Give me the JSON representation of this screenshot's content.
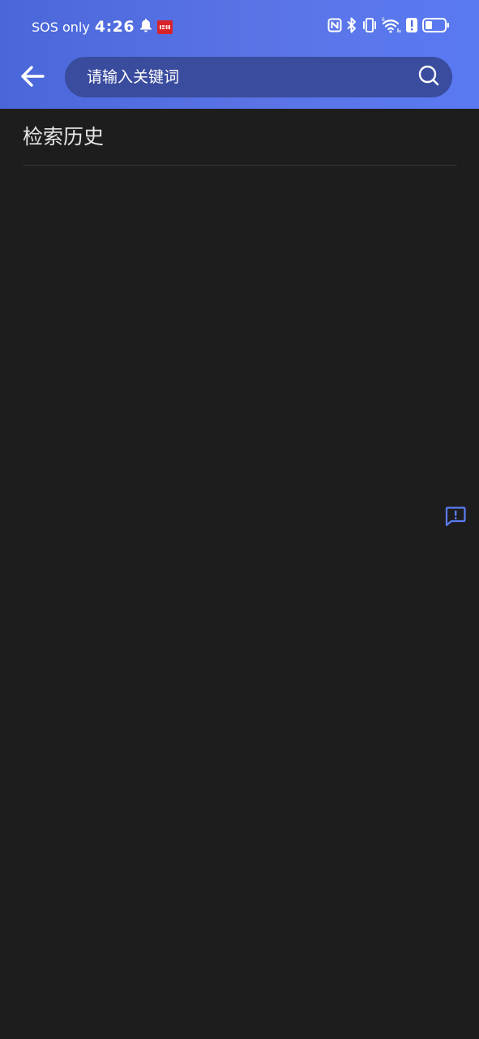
{
  "status_bar": {
    "carrier": "SOS only",
    "time": "4:26",
    "app_badge_icon": "app-notification-badge-icon",
    "icons": [
      "bell-icon",
      "nfc-icon",
      "bluetooth-icon",
      "vibrate-icon",
      "wifi-6-icon",
      "alert-icon",
      "battery-icon"
    ]
  },
  "toolbar": {
    "back_icon": "arrow-left-icon",
    "search_icon": "search-icon"
  },
  "search": {
    "placeholder": "请输入关键词",
    "value": ""
  },
  "history": {
    "title": "检索历史",
    "items": []
  },
  "feedback": {
    "icon": "feedback-icon"
  },
  "colors": {
    "header_gradient_start": "#4a67d9",
    "header_gradient_end": "#5a7af2",
    "search_box_bg": "#3a4c9e",
    "page_bg": "#1d1d1d",
    "accent": "#5b7cf5"
  }
}
